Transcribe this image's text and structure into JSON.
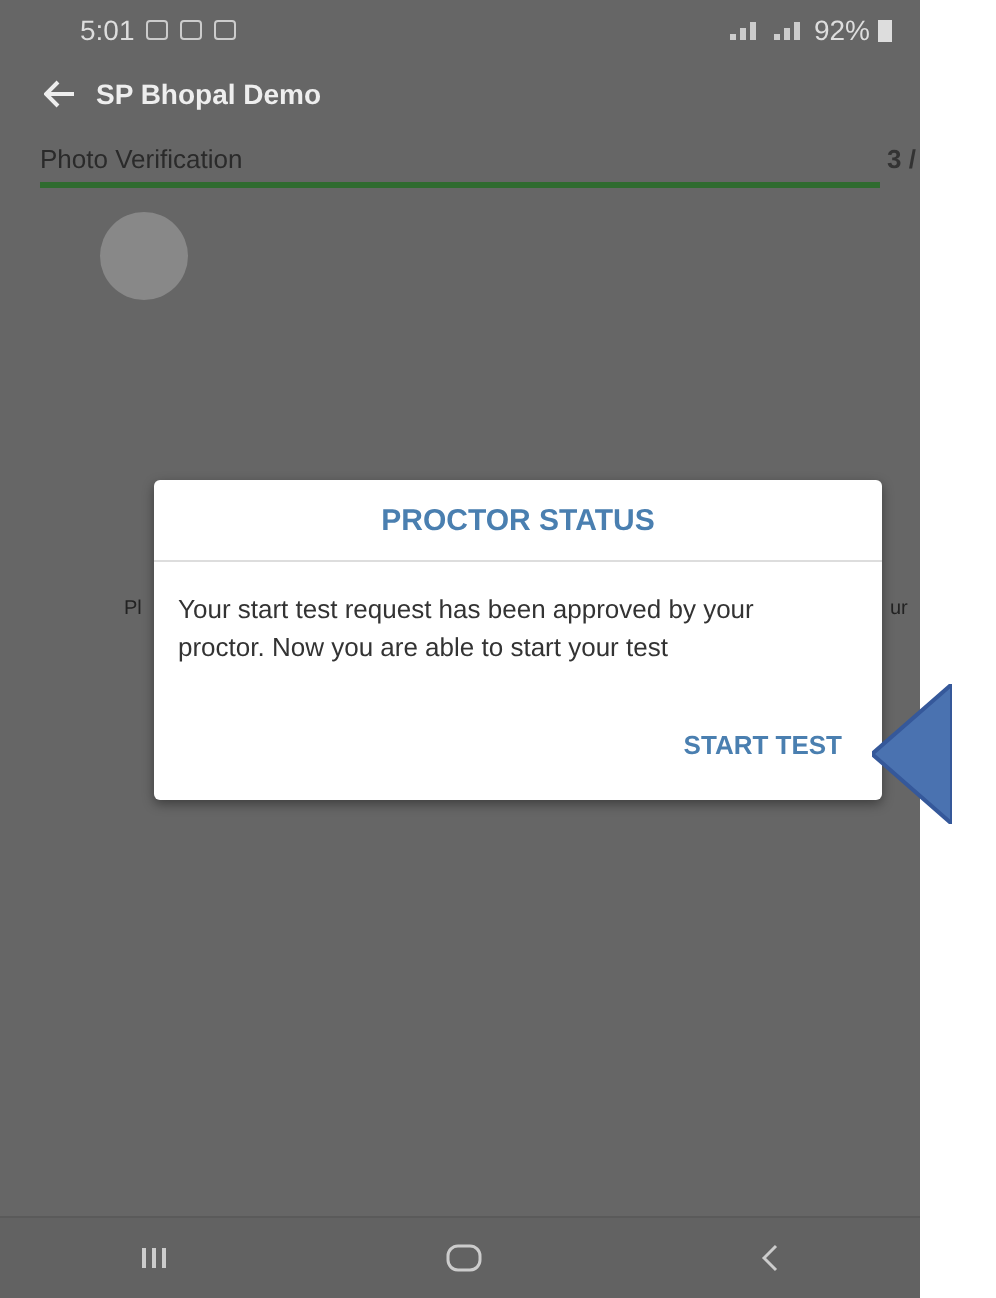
{
  "status_bar": {
    "time": "5:01",
    "battery": "92%"
  },
  "app_bar": {
    "title": "SP Bhopal Demo"
  },
  "step": {
    "label": "Photo Verification",
    "counter": "3 /",
    "level": 1
  },
  "background_text": [
    "Pl",
    "ur"
  ],
  "dialog": {
    "title": "PROCTOR STATUS",
    "message": "Your start test request has been approved by your proctor. Now you are able to start your test",
    "button": "START TEST"
  }
}
